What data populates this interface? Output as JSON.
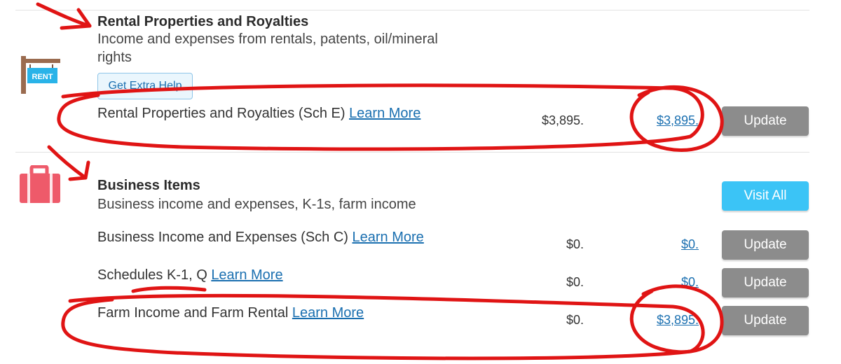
{
  "rental": {
    "title": "Rental Properties and Royalties",
    "subtitle_line1": "Income and expenses from rentals, patents, oil/mineral",
    "subtitle_line2": "rights",
    "help_label": "Get Extra Help",
    "icon_text": "RENT",
    "row": {
      "label": "Rental Properties and Royalties (Sch E)",
      "learn_more": "Learn More",
      "prior_amount": "$3,895.",
      "current_amount": "$3,895.",
      "button": "Update"
    }
  },
  "business": {
    "title": "Business Items",
    "subtitle": "Business income and expenses, K-1s, farm income",
    "visit_all": "Visit All",
    "rows": [
      {
        "label": "Business Income and Expenses (Sch C)",
        "learn_more": "Learn More",
        "prior_amount": "$0.",
        "current_amount": "$0.",
        "button": "Update"
      },
      {
        "label": "Schedules K-1, Q",
        "learn_more": "Learn More",
        "prior_amount": "$0.",
        "current_amount": "$0.",
        "button": "Update"
      },
      {
        "label": "Farm Income and Farm Rental",
        "learn_more": "Learn More",
        "prior_amount": "$0.",
        "current_amount": "$3,895.",
        "button": "Update"
      }
    ]
  },
  "colors": {
    "link": "#1a6fb0",
    "update_button": "#8c8c8c",
    "visit_all_button": "#3bc4f6",
    "annotation_red": "#e01414",
    "briefcase": "#ee5a6a"
  }
}
